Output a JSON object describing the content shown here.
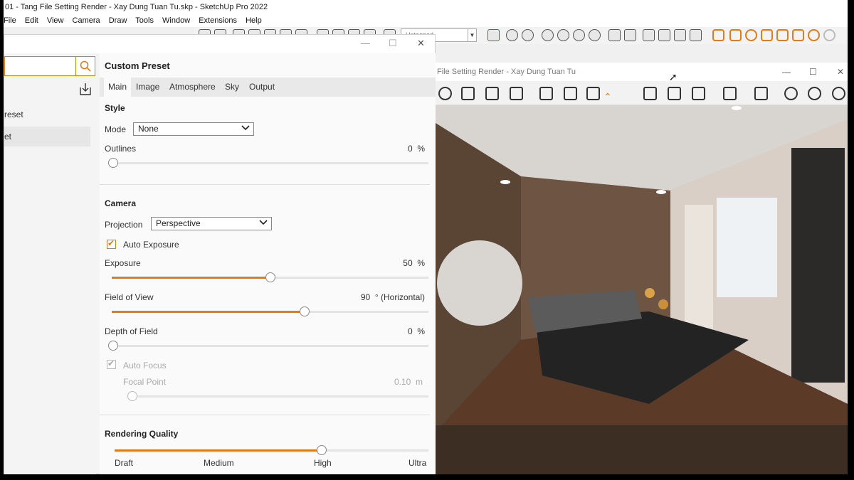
{
  "sketchup": {
    "title": "01 - Tang File Setting Render - Xay Dung Tuan Tu.skp - SketchUp Pro 2022",
    "menu": [
      "File",
      "Edit",
      "View",
      "Camera",
      "Draw",
      "Tools",
      "Window",
      "Extensions",
      "Help"
    ],
    "layer_select": "Untagged"
  },
  "vfb": {
    "title": "File Setting Render - Xay Dung Tuan Tu",
    "min": "—",
    "max": "☐",
    "close": "✕"
  },
  "panel": {
    "min": "—",
    "max": "☐",
    "close": "✕",
    "presets": [
      "reset",
      "et"
    ],
    "title": "Custom Preset",
    "tabs": [
      "Main",
      "Image",
      "Atmosphere",
      "Sky",
      "Output"
    ],
    "style": {
      "heading": "Style",
      "mode_label": "Mode",
      "mode_value": "None",
      "outlines_label": "Outlines",
      "outlines_value": "0",
      "outlines_unit": "%"
    },
    "camera": {
      "heading": "Camera",
      "projection_label": "Projection",
      "projection_value": "Perspective",
      "auto_exposure_label": "Auto Exposure",
      "auto_exposure_checked": true,
      "exposure_label": "Exposure",
      "exposure_value": "50",
      "exposure_unit": "%",
      "exposure_level": 0.5,
      "fov_label": "Field of View",
      "fov_value": "90",
      "fov_unit": "° (Horizontal)",
      "fov_level": 0.61,
      "dof_label": "Depth of Field",
      "dof_value": "0",
      "dof_unit": "%",
      "auto_focus_label": "Auto Focus",
      "focal_point_label": "Focal Point",
      "focal_point_value": "0.10",
      "focal_point_unit": "m"
    },
    "quality": {
      "heading": "Rendering Quality",
      "levels": [
        "Draft",
        "Medium",
        "High",
        "Ultra"
      ],
      "selected": "High",
      "level": 0.66
    }
  },
  "colors": {
    "accent": "#e07b1a"
  },
  "icons": [
    "search-icon",
    "import-icon",
    "chevron-down-icon",
    "check-icon",
    "cursor-icon"
  ]
}
